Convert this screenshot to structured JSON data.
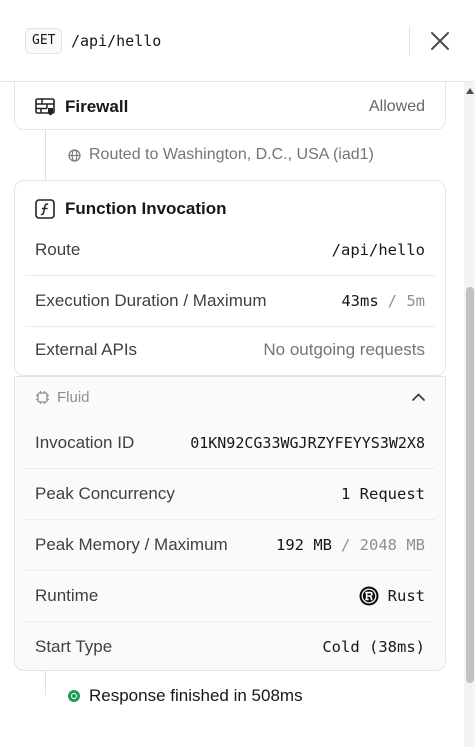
{
  "header": {
    "method": "GET",
    "path": "/api/hello"
  },
  "firewall": {
    "title": "Firewall",
    "status": "Allowed"
  },
  "routing": {
    "text": "Routed to Washington, D.C., USA (iad1)"
  },
  "function_invocation": {
    "title": "Function Invocation",
    "rows": [
      {
        "label": "Route",
        "value": "/api/hello"
      },
      {
        "label": "Execution Duration / Maximum",
        "value": "43ms",
        "max": "/ 5m"
      },
      {
        "label": "External APIs",
        "value": "No outgoing requests"
      }
    ]
  },
  "fluid": {
    "label": "Fluid",
    "rows": [
      {
        "label": "Invocation ID",
        "value": "01KN92CG33WGJRZYFEYYS3W2X8"
      },
      {
        "label": "Peak Concurrency",
        "value": "1 Request"
      },
      {
        "label": "Peak Memory / Maximum",
        "value": "192 MB",
        "max": "/ 2048 MB"
      },
      {
        "label": "Runtime",
        "value": "Rust",
        "icon": "rust-icon"
      },
      {
        "label": "Start Type",
        "value": "Cold (38ms)"
      }
    ]
  },
  "response": {
    "text": "Response finished in 508ms"
  },
  "colors": {
    "success": "#1f9d55",
    "border": "#e5e5e5",
    "muted": "#8f8f8f"
  }
}
